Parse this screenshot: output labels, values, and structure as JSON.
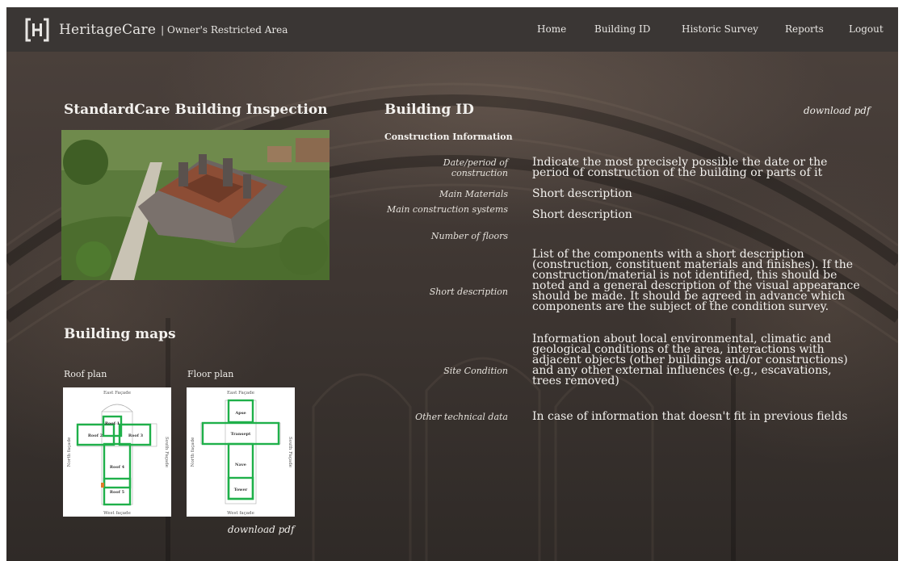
{
  "navbar": {
    "brand": "HeritageCare",
    "subtitle": "| Owner's Restricted Area",
    "links": [
      "Home",
      "Building ID",
      "Historic Survey",
      "Reports",
      "Logout"
    ]
  },
  "left": {
    "inspection_title": "StandardCare Building Inspection",
    "maps_title": "Building maps",
    "roof_plan_label": "Roof plan",
    "floor_plan_label": "Floor plan",
    "maps_download": "download pdf",
    "roof_plan": {
      "top": "East Façade",
      "bottom": "West façade",
      "left": "North façade",
      "right": "South Façade",
      "labels": [
        "Roof 1",
        "Roof 2",
        "Roof 3",
        "Roof 4",
        "Roof 5"
      ]
    },
    "floor_plan": {
      "top": "East Façade",
      "bottom": "West façade",
      "left": "North façade",
      "right": "South Façade",
      "labels": [
        "Apse",
        "Transept",
        "Nave",
        "Tower"
      ]
    }
  },
  "building": {
    "title": "Building ID",
    "download": "download pdf",
    "section": "Construction Information",
    "rows": [
      {
        "label": "Date/period of construction",
        "value": "Indicate the most precisely possible the date or the period of construction of the building or parts of it"
      },
      {
        "label": "Main Materials",
        "value": "Short description"
      },
      {
        "label": "Main construction systems",
        "value": "Short description"
      },
      {
        "label": "Number of floors",
        "value": ""
      },
      {
        "label": "Short description",
        "value": "List of the components with a short description (construction, constituent materials and finishes). If the construction/material is not identified, this should be noted and a general description of the visual appearance should be made. It should be agreed in advance which components are the subject of the condition survey."
      },
      {
        "label": "Site Condition",
        "value": "Information about local environmental, climatic and geological conditions of the area, interactions with adjacent objects (other buildings and/or constructions) and any other external influences (e.g., escavations, trees removed)"
      },
      {
        "label": "Other technical data",
        "value": "In case of information that doesn't fit in previous fields"
      }
    ]
  }
}
